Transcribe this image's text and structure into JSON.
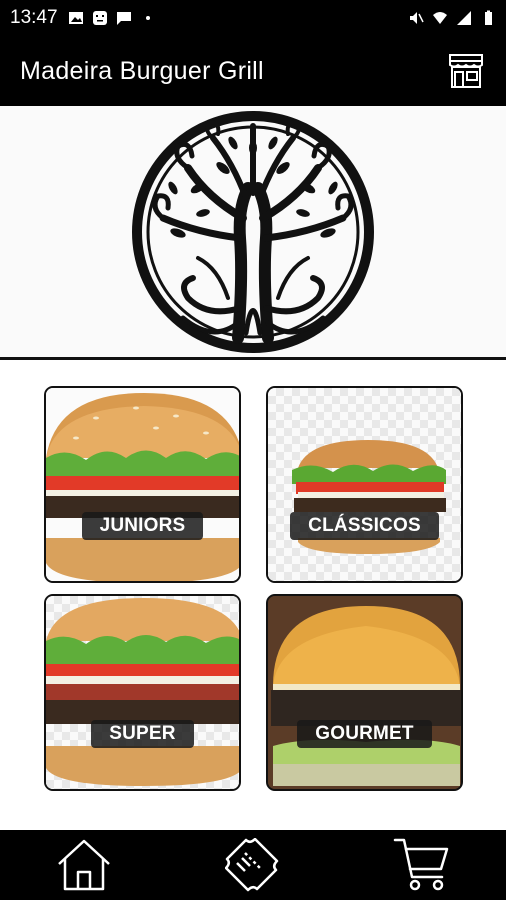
{
  "status_bar": {
    "time": "13:47",
    "left_icons": [
      "image-icon",
      "face-icon",
      "message-icon",
      "dot-icon"
    ],
    "right_icons": [
      "mute-icon",
      "wifi-icon",
      "signal-icon",
      "battery-icon"
    ]
  },
  "app_bar": {
    "title": "Madeira Burguer Grill",
    "action_icon": "store-icon"
  },
  "banner": {
    "logo": "tree-of-life-logo"
  },
  "categories": [
    {
      "label": "JUNIORS"
    },
    {
      "label": "CLÁSSICOS"
    },
    {
      "label": "SUPER"
    },
    {
      "label": "GOURMET"
    }
  ],
  "bottom_nav": {
    "items": [
      "home-icon",
      "ticket-icon",
      "cart-icon"
    ]
  }
}
